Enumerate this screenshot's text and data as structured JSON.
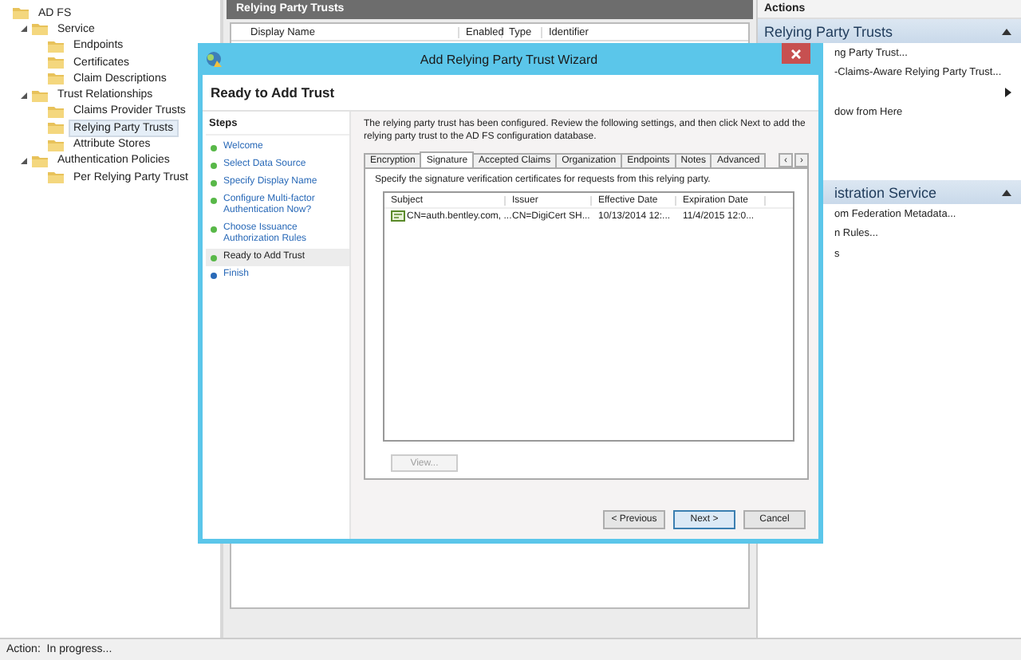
{
  "tree": [
    {
      "label": "AD FS",
      "selected": false,
      "children": [
        {
          "label": "Service",
          "expanded": true,
          "selected": false,
          "children": [
            {
              "label": "Endpoints",
              "selected": false
            },
            {
              "label": "Certificates",
              "selected": false
            },
            {
              "label": "Claim Descriptions",
              "selected": false
            }
          ]
        },
        {
          "label": "Trust Relationships",
          "expanded": true,
          "selected": false,
          "children": [
            {
              "label": "Claims Provider Trusts",
              "selected": false
            },
            {
              "label": "Relying Party Trusts",
              "selected": true
            },
            {
              "label": "Attribute Stores",
              "selected": false
            }
          ]
        },
        {
          "label": "Authentication Policies",
          "expanded": true,
          "selected": false,
          "children": [
            {
              "label": "Per Relying Party Trust",
              "selected": false
            }
          ]
        }
      ]
    }
  ],
  "center": {
    "title": "Relying Party Trusts",
    "columns": [
      "Display Name",
      "Enabled",
      "Type",
      "Identifier"
    ]
  },
  "actions": {
    "title": "Actions",
    "sections": [
      {
        "title": "Relying Party Trusts",
        "items": [
          {
            "label": "ng Party Trust...",
            "submenu": false
          },
          {
            "label": "-Claims-Aware Relying Party Trust...",
            "submenu": false
          },
          {
            "submenu": true
          },
          {
            "label": "dow from Here",
            "submenu": false
          }
        ]
      },
      {
        "title": "istration Service",
        "items": [
          {
            "label": "om Federation Metadata...",
            "submenu": false
          },
          {
            "label": "n Rules...",
            "submenu": false
          },
          {
            "label": "s",
            "submenu": false
          }
        ]
      }
    ]
  },
  "dialog": {
    "title": "Add Relying Party Trust Wizard",
    "heading": "Ready to Add Trust",
    "steps_title": "Steps",
    "steps": [
      {
        "label": "Welcome",
        "done": true,
        "selected": false
      },
      {
        "label": "Select Data Source",
        "done": true,
        "selected": false
      },
      {
        "label": "Specify Display Name",
        "done": true,
        "selected": false
      },
      {
        "label": "Configure Multi-factor Authentication Now?",
        "done": true,
        "selected": false
      },
      {
        "label": "Choose Issuance Authorization Rules",
        "done": true,
        "selected": false
      },
      {
        "label": "Ready to Add Trust",
        "done": true,
        "selected": true
      },
      {
        "label": "Finish",
        "done": false,
        "selected": false
      }
    ],
    "intro": "The relying party trust has been configured. Review the following settings, and then click Next to add the relying party trust to the AD FS configuration database.",
    "tabs": [
      {
        "label": "Encryption",
        "selected": false
      },
      {
        "label": "Signature",
        "selected": true
      },
      {
        "label": "Accepted Claims",
        "selected": false
      },
      {
        "label": "Organization",
        "selected": false
      },
      {
        "label": "Endpoints",
        "selected": false
      },
      {
        "label": "Notes",
        "selected": false
      },
      {
        "label": "Advanced",
        "selected": false
      }
    ],
    "tab_scroll": [
      "‹",
      "›"
    ],
    "description": "Specify the signature verification certificates for requests from this relying party.",
    "table": {
      "columns": [
        "Subject",
        "Issuer",
        "Effective Date",
        "Expiration Date"
      ],
      "rows": [
        [
          "CN=auth.bentley.com, ...",
          "CN=DigiCert SH...",
          "10/13/2014 12:...",
          "11/4/2015 12:0..."
        ]
      ]
    },
    "view_button": {
      "label": "View...",
      "disabled": true
    },
    "buttons": [
      {
        "label": "< Previous",
        "focused": false
      },
      {
        "label": "Next >",
        "focused": true
      },
      {
        "label": "Cancel",
        "focused": false
      }
    ]
  },
  "status_bar": "Action:  In progress..."
}
